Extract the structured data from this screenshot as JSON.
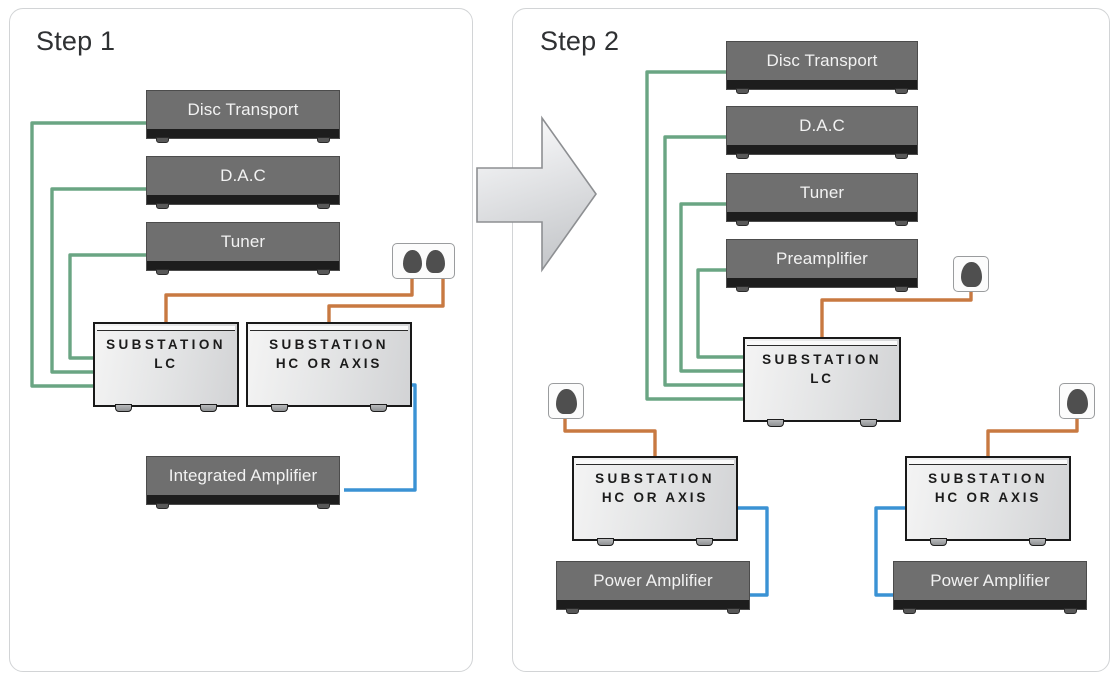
{
  "colors": {
    "signal_cable_green": "#6aa583",
    "power_cable_orange": "#c87941",
    "speaker_cable_blue": "#3a92d4",
    "device_body": "#6f6f6f",
    "substation_body": "#e6e7e8",
    "panel_border": "#d2d4d6",
    "arrow_fill": "#d9dbdd"
  },
  "panels": [
    {
      "id": "step1",
      "title": "Step 1"
    },
    {
      "id": "step2",
      "title": "Step 2"
    }
  ],
  "arrow": {
    "name": "step-progress-arrow",
    "direction": "right"
  },
  "step1": {
    "title": "Step 1",
    "sources": [
      {
        "label": "Disc Transport"
      },
      {
        "label": "D.A.C"
      },
      {
        "label": "Tuner"
      }
    ],
    "substations": [
      {
        "brand": "SUBSTATION",
        "model": "LC"
      },
      {
        "brand": "SUBSTATION",
        "model": "HC OR AXIS"
      }
    ],
    "amplifier": {
      "label": "Integrated Amplifier"
    },
    "outlet": {
      "name": "wall-outlet-double",
      "plugs": 2
    }
  },
  "step2": {
    "title": "Step 2",
    "sources": [
      {
        "label": "Disc Transport"
      },
      {
        "label": "D.A.C"
      },
      {
        "label": "Tuner"
      },
      {
        "label": "Preamplifier"
      }
    ],
    "substations": [
      {
        "brand": "SUBSTATION",
        "model": "LC"
      },
      {
        "brand": "SUBSTATION",
        "model": "HC OR AXIS"
      },
      {
        "brand": "SUBSTATION",
        "model": "HC OR AXIS"
      }
    ],
    "amplifiers": [
      {
        "label": "Power Amplifier"
      },
      {
        "label": "Power Amplifier"
      }
    ],
    "outlets": [
      {
        "name": "wall-outlet-single-left",
        "plugs": 1
      },
      {
        "name": "wall-outlet-single-center",
        "plugs": 1
      },
      {
        "name": "wall-outlet-single-right",
        "plugs": 1
      }
    ]
  }
}
